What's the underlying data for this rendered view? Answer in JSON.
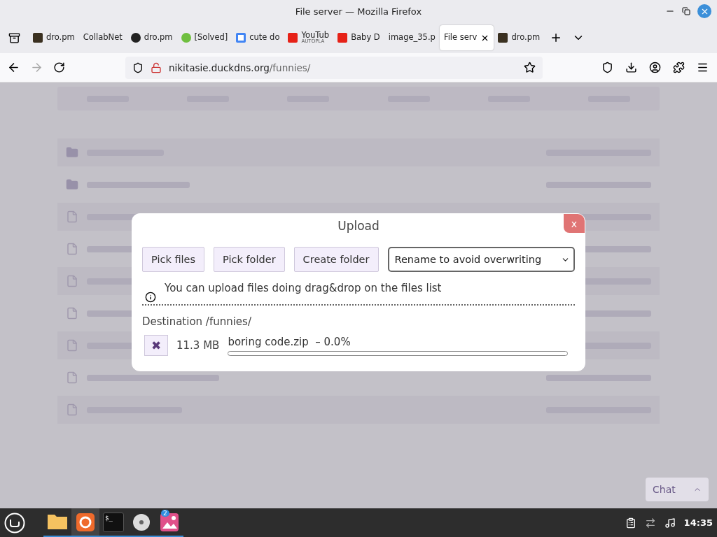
{
  "window": {
    "title": "File server — Mozilla Firefox"
  },
  "tabs": [
    {
      "label": "dro.pm",
      "kind": "dark",
      "selected": false
    },
    {
      "label": "CollabNet",
      "kind": "none",
      "selected": false
    },
    {
      "label": "dro.pm",
      "kind": "github",
      "selected": false
    },
    {
      "label": "[Solved]",
      "kind": "mint",
      "selected": false
    },
    {
      "label": "cute do",
      "kind": "google",
      "selected": false
    },
    {
      "label": "YouTub",
      "sub": "AUTOPLA",
      "kind": "youtube",
      "selected": false
    },
    {
      "label": "Baby D",
      "kind": "youtube",
      "selected": false
    },
    {
      "label": "image_35.p",
      "kind": "none",
      "selected": false
    },
    {
      "label": "File serv",
      "kind": "none",
      "selected": true
    },
    {
      "label": "dro.pm",
      "kind": "dark",
      "selected": false
    }
  ],
  "address": {
    "domain": "nikitasie.duckdns.org",
    "path": "/funnies/"
  },
  "background_page": {
    "rows": [
      {
        "kind": "folder"
      },
      {
        "kind": "folder"
      },
      {
        "kind": "file"
      },
      {
        "kind": "file"
      },
      {
        "kind": "file"
      },
      {
        "kind": "file"
      },
      {
        "kind": "file"
      },
      {
        "kind": "file"
      },
      {
        "kind": "file"
      }
    ]
  },
  "dialog": {
    "title": "Upload",
    "close": "x",
    "buttons": [
      "Pick files",
      "Pick folder",
      "Create folder"
    ],
    "mode": "Rename to avoid overwriting",
    "info": "You can upload files doing drag&drop on the files list",
    "destination": "Destination /funnies/",
    "uploads": [
      {
        "cancel": "✖",
        "size": "11.3 MB",
        "name": "boring code.zip",
        "progress": "– 0.0%",
        "level": 0
      }
    ]
  },
  "chat": {
    "label": "Chat"
  },
  "taskbar": {
    "apps": [
      {
        "kind": "files",
        "selected": false
      },
      {
        "kind": "firefox",
        "selected": true
      },
      {
        "kind": "terminal",
        "label": "$_",
        "selected": false
      },
      {
        "kind": "disc",
        "selected": false
      },
      {
        "kind": "photos",
        "badge": "2",
        "selected": false
      }
    ],
    "clock": "14:35"
  }
}
